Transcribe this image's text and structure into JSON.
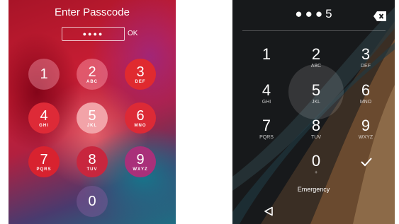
{
  "ios": {
    "title": "Enter Passcode",
    "entered": "●●●●",
    "ok_label": "OK",
    "keys": [
      {
        "digit": "1",
        "letters": ""
      },
      {
        "digit": "2",
        "letters": "ABC"
      },
      {
        "digit": "3",
        "letters": "DEF"
      },
      {
        "digit": "4",
        "letters": "GHI"
      },
      {
        "digit": "5",
        "letters": "JKL"
      },
      {
        "digit": "6",
        "letters": "MNO"
      },
      {
        "digit": "7",
        "letters": "PQRS"
      },
      {
        "digit": "8",
        "letters": "TUV"
      },
      {
        "digit": "9",
        "letters": "WXYZ"
      },
      {
        "digit": "0",
        "letters": ""
      }
    ]
  },
  "android": {
    "entered_dots": "●●●",
    "entered_last": "5",
    "keys": [
      {
        "digit": "1",
        "letters": ""
      },
      {
        "digit": "2",
        "letters": "ABC"
      },
      {
        "digit": "3",
        "letters": "DEF"
      },
      {
        "digit": "4",
        "letters": "GHI"
      },
      {
        "digit": "5",
        "letters": "JKL"
      },
      {
        "digit": "6",
        "letters": "MNO"
      },
      {
        "digit": "7",
        "letters": "PQRS"
      },
      {
        "digit": "8",
        "letters": "TUV"
      },
      {
        "digit": "9",
        "letters": "WXYZ"
      },
      {
        "digit": "0",
        "letters": "+"
      }
    ],
    "emergency_label": "Emergency",
    "icons": {
      "backspace": "backspace-icon",
      "confirm": "checkmark-icon",
      "nav_back": "back-triangle-icon"
    }
  }
}
